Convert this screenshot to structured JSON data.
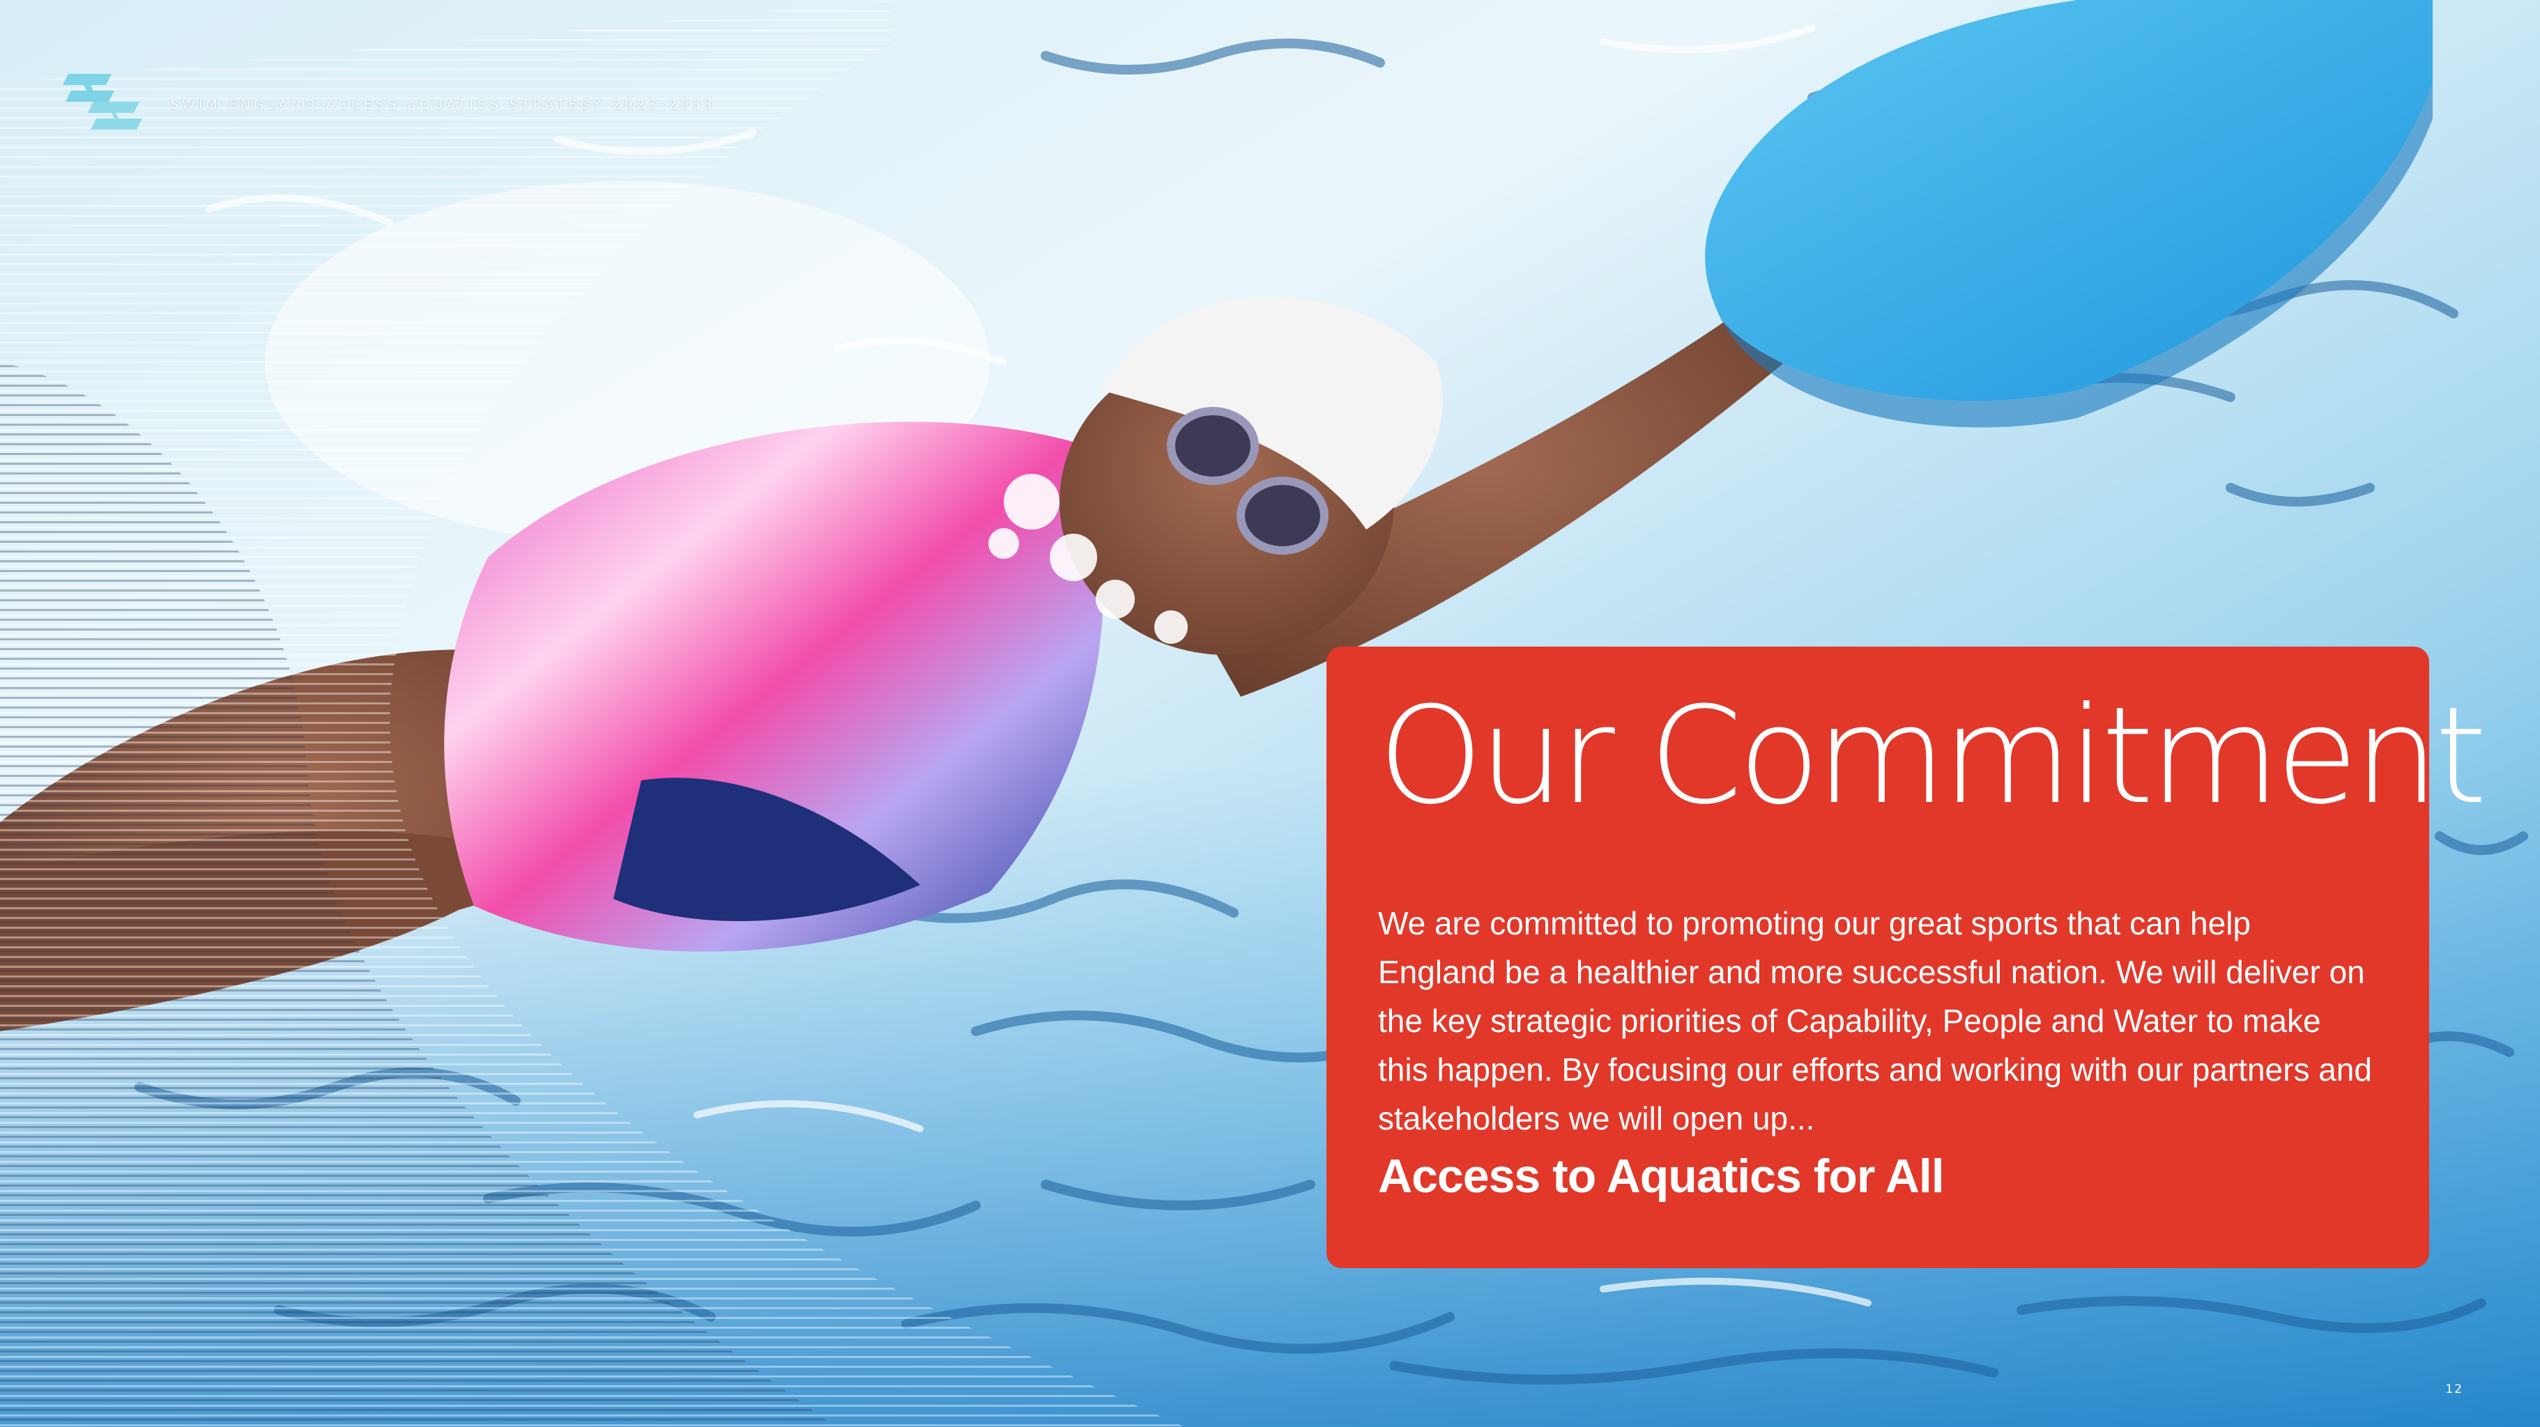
{
  "header": {
    "document_title": "SWIM ENGLAND ACCESS AQUATICS STRATEGY 2023-2033"
  },
  "panel": {
    "title": "Our Commitment",
    "body": "We are committed to promoting our great sports that can help England be a healthier and more successful nation. We will deliver on the key strategic priorities of Capability, People and Water to make this happen. By focusing our efforts and working with our partners and stakeholders we will open up...",
    "cta": "Access to Aquatics for All"
  },
  "footer": {
    "page_number": "12"
  },
  "icons": {
    "logo": "swim-england-logo-icon"
  },
  "colors": {
    "panel_background": "#e1382a",
    "text": "#ffffff",
    "logo_accent": "#7fd3e6",
    "kickboard": "#35aeea"
  }
}
